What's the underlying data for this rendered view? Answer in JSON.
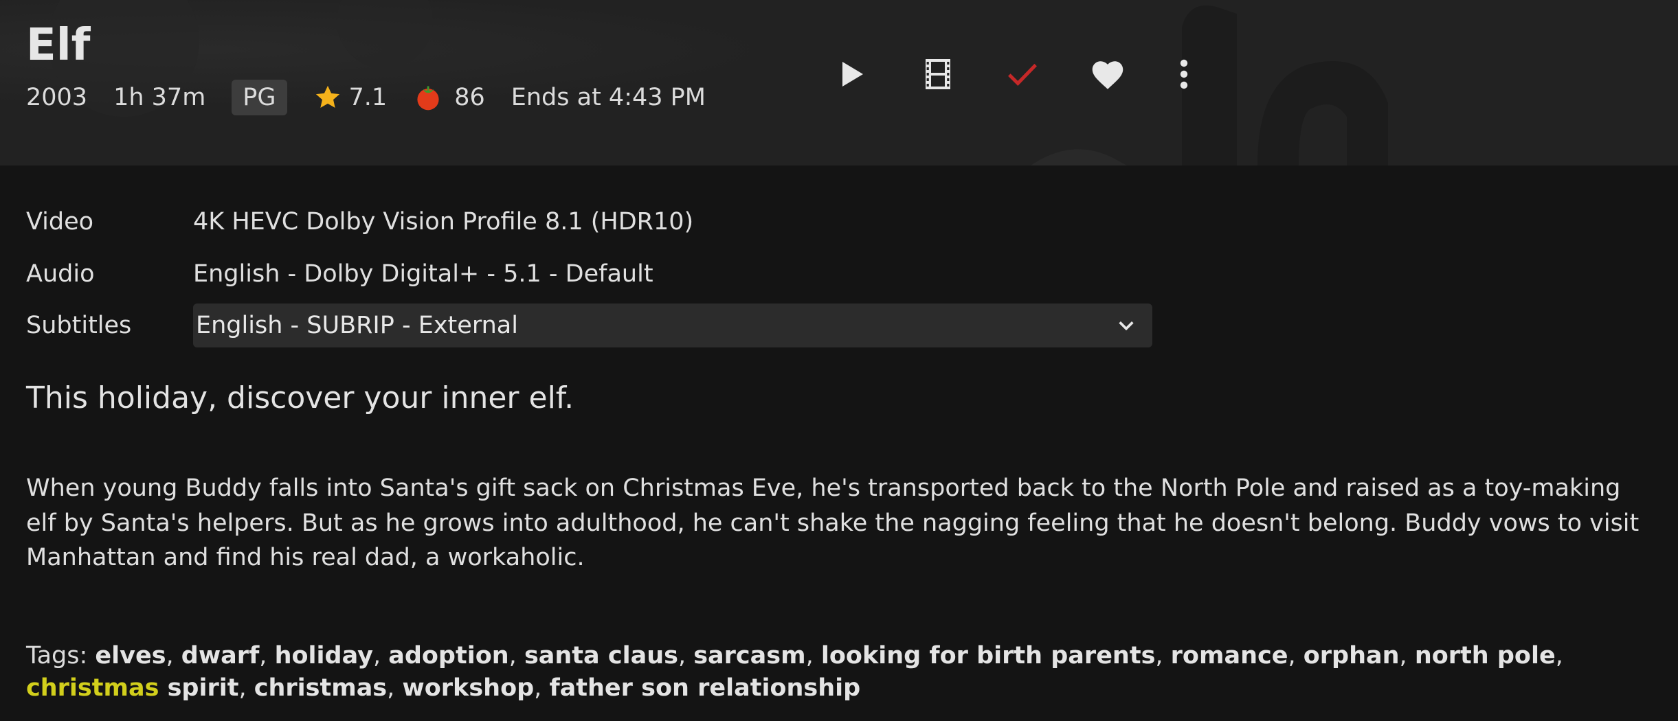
{
  "header": {
    "title": "Elf",
    "year": "2003",
    "runtime": "1h 37m",
    "rating": "PG",
    "community_rating": "7.1",
    "critic_rating": "86",
    "ends_at": "Ends at 4:43 PM",
    "icons": {
      "star": "star-icon",
      "tomato": "tomato-icon"
    }
  },
  "actions": {
    "play": "play-icon",
    "trailer": "film-icon",
    "played": "check-icon",
    "favorite": "heart-icon",
    "more": "more-vert-icon",
    "played_color": "#c62828",
    "icon_color": "#e8e8e8"
  },
  "media": {
    "video_label": "Video",
    "video_value": "4K HEVC Dolby Vision Profile 8.1 (HDR10)",
    "audio_label": "Audio",
    "audio_value": "English - Dolby Digital+ - 5.1 - Default",
    "subtitles_label": "Subtitles",
    "subtitles_value": "English - SUBRIP - External"
  },
  "tagline": "This holiday, discover your inner elf.",
  "overview": "When young Buddy falls into Santa's gift sack on Christmas Eve, he's transported back to the North Pole and raised as a toy-making elf by Santa's helpers. But as he grows into adulthood, he can't shake the nagging feeling that he doesn't belong. Buddy vows to visit Manhattan and find his real dad, a workaholic.",
  "tags": {
    "label": "Tags: ",
    "items": [
      "elves",
      "dwarf",
      "holiday",
      "adoption",
      "santa claus",
      "sarcasm",
      "looking for birth parents",
      "romance",
      "orphan",
      "north pole",
      "christmas spirit",
      "christmas",
      "workshop",
      "father son relationship"
    ],
    "highlight_color": "#d2cf1c"
  },
  "colors": {
    "background": "#141414",
    "header_background": "#222222",
    "star": "#f5b21b",
    "tomato": "#e33b1a"
  }
}
